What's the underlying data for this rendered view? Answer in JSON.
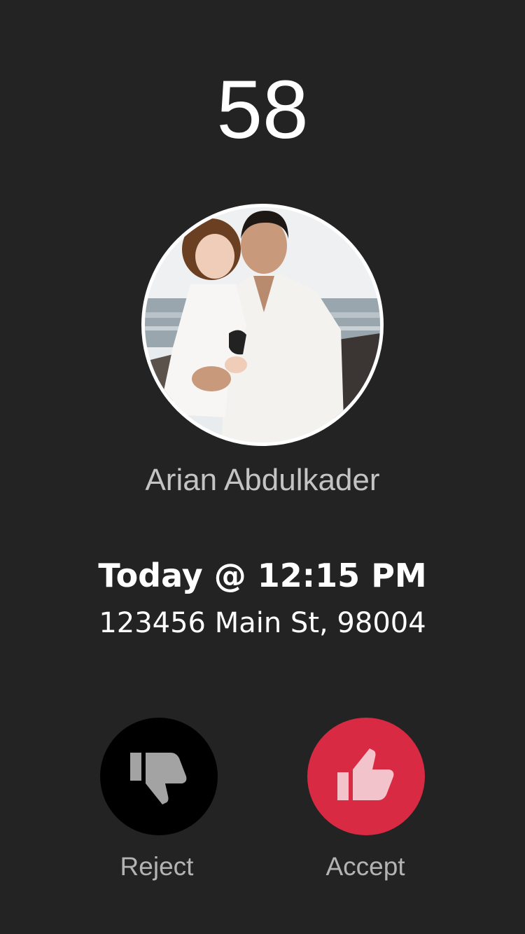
{
  "countdown": "58",
  "customer": {
    "name": "Arian Abdulkader"
  },
  "appointment": {
    "time": "Today @ 12:15 PM",
    "address": "123456 Main St, 98004"
  },
  "actions": {
    "reject": {
      "label": "Reject",
      "icon": "thumbs-down-icon",
      "color": "#000000"
    },
    "accept": {
      "label": "Accept",
      "icon": "thumbs-up-icon",
      "color": "#d92a44"
    }
  }
}
